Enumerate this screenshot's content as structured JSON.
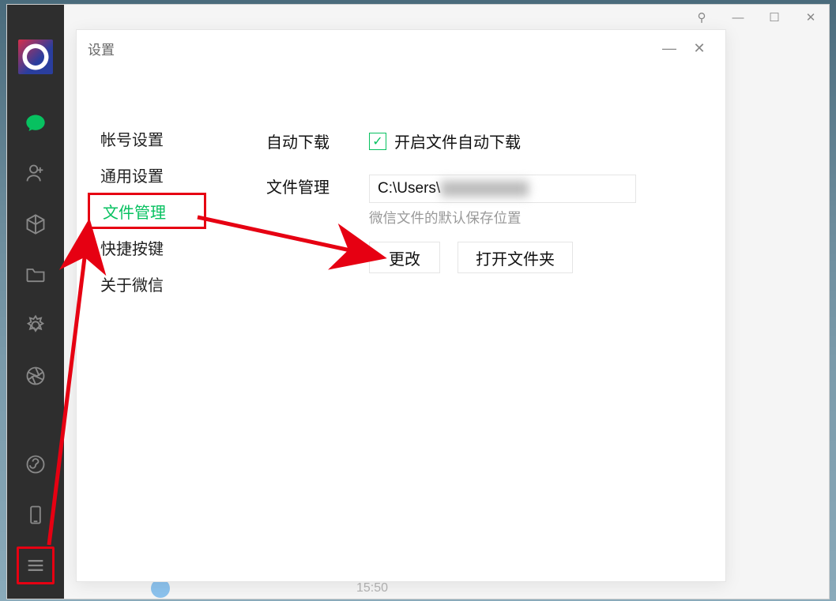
{
  "settings_title": "设置",
  "nav": {
    "account": "帐号设置",
    "general": "通用设置",
    "files": "文件管理",
    "shortcuts": "快捷按键",
    "about": "关于微信"
  },
  "section": {
    "auto_download_label": "自动下载",
    "auto_download_checkbox_label": "开启文件自动下载",
    "file_manage_label": "文件管理",
    "file_path_prefix": "C:\\Users\\",
    "file_hint": "微信文件的默认保存位置",
    "change_btn": "更改",
    "open_folder_btn": "打开文件夹"
  },
  "titlebar": {
    "pin_glyph": "⚲",
    "min_glyph": "—",
    "max_glyph": "☐",
    "close_glyph": "✕"
  },
  "icons": {
    "chat": "chat-bubble",
    "contacts": "user-plus",
    "favorites": "cube",
    "files": "folder",
    "moments": "gear-flower",
    "camera": "aperture",
    "miniprogram": "mini-program",
    "phone": "phone",
    "menu": "hamburger"
  },
  "chat_hint_time": "15:50",
  "colors": {
    "accent": "#07c160",
    "annotation": "#e60012"
  }
}
